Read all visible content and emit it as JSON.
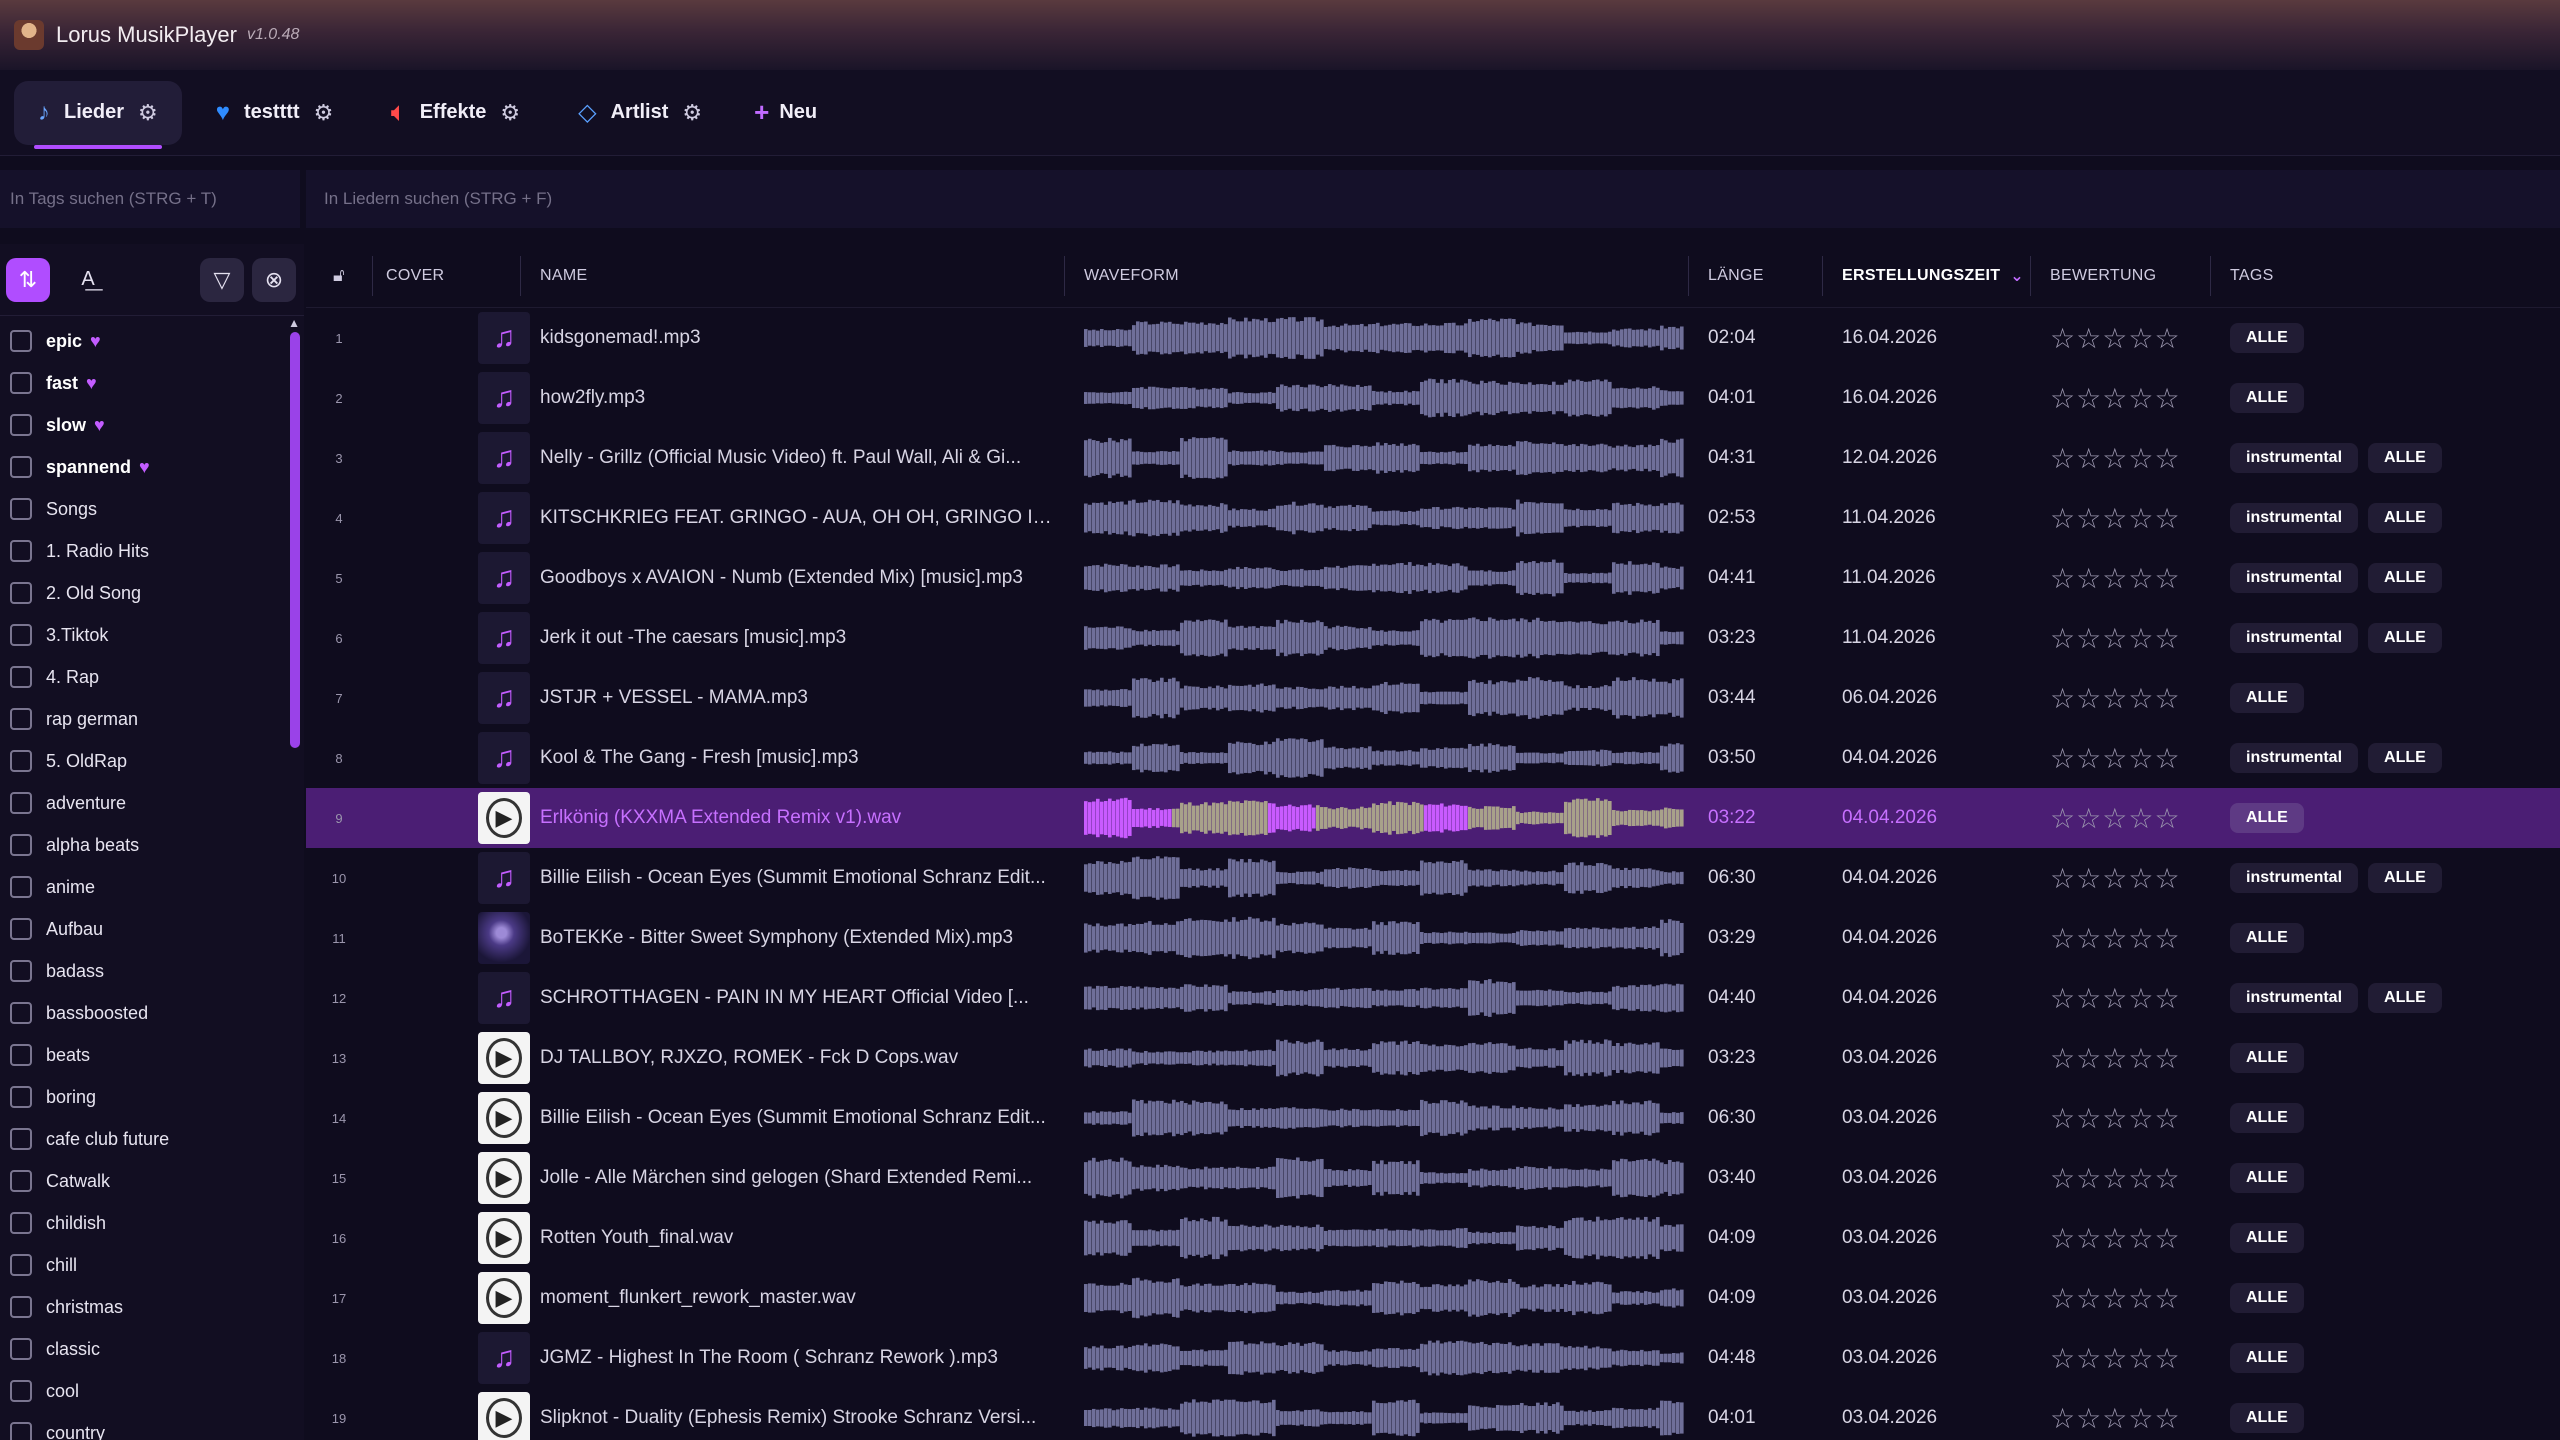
{
  "app": {
    "title": "Lorus MusikPlayer",
    "version": "v1.0.48"
  },
  "tabs": [
    {
      "label": "Lieder",
      "icon": "music-note-icon",
      "active": true
    },
    {
      "label": "testttt",
      "icon": "heart-icon",
      "active": false
    },
    {
      "label": "Effekte",
      "icon": "speaker-icon",
      "active": false
    },
    {
      "label": "Artlist",
      "icon": "tag-icon",
      "active": false
    }
  ],
  "new_tab_label": "Neu",
  "search": {
    "tags_placeholder": "In Tags suchen (STRG + T)",
    "songs_placeholder": "In Liedern suchen (STRG + F)"
  },
  "sidebar": {
    "tags": [
      {
        "label": "epic",
        "fav": true
      },
      {
        "label": "fast",
        "fav": true
      },
      {
        "label": "slow",
        "fav": true
      },
      {
        "label": "spannend",
        "fav": true
      },
      {
        "label": "Songs",
        "fav": false
      },
      {
        "label": "1. Radio Hits",
        "fav": false
      },
      {
        "label": "2. Old Song",
        "fav": false
      },
      {
        "label": "3.Tiktok",
        "fav": false
      },
      {
        "label": "4. Rap",
        "fav": false
      },
      {
        "label": "rap german",
        "fav": false
      },
      {
        "label": "5. OldRap",
        "fav": false
      },
      {
        "label": "adventure",
        "fav": false
      },
      {
        "label": "alpha beats",
        "fav": false
      },
      {
        "label": "anime",
        "fav": false
      },
      {
        "label": "Aufbau",
        "fav": false
      },
      {
        "label": "badass",
        "fav": false
      },
      {
        "label": "bassboosted",
        "fav": false
      },
      {
        "label": "beats",
        "fav": false
      },
      {
        "label": "boring",
        "fav": false
      },
      {
        "label": "cafe club future",
        "fav": false
      },
      {
        "label": "Catwalk",
        "fav": false
      },
      {
        "label": "childish",
        "fav": false
      },
      {
        "label": "chill",
        "fav": false
      },
      {
        "label": "christmas",
        "fav": false
      },
      {
        "label": "classic",
        "fav": false
      },
      {
        "label": "cool",
        "fav": false
      },
      {
        "label": "country",
        "fav": false
      }
    ]
  },
  "table": {
    "headers": {
      "cover": "COVER",
      "name": "NAME",
      "waveform": "WAVEFORM",
      "length": "LÄNGE",
      "created": "ERSTELLUNGSZEIT",
      "rating": "BEWERTUNG",
      "tags": "TAGS"
    },
    "sort_column": "ERSTELLUNGSZEIT",
    "rows": [
      {
        "n": "1",
        "cover": "note",
        "name": "kidsgonemad!.mp3",
        "length": "02:04",
        "date": "16.04.2026",
        "tags": [
          "ALLE"
        ]
      },
      {
        "n": "2",
        "cover": "note",
        "name": "how2fly.mp3",
        "length": "04:01",
        "date": "16.04.2026",
        "tags": [
          "ALLE"
        ]
      },
      {
        "n": "3",
        "cover": "note",
        "name": "Nelly - Grillz (Official Music Video) ft. Paul Wall, Ali & Gi...",
        "length": "04:31",
        "date": "12.04.2026",
        "tags": [
          "instrumental",
          "ALLE"
        ]
      },
      {
        "n": "4",
        "cover": "note",
        "name": "KITSCHKRIEG FEAT. GRINGO - AUA, OH OH, GRINGO IST...",
        "length": "02:53",
        "date": "11.04.2026",
        "tags": [
          "instrumental",
          "ALLE"
        ]
      },
      {
        "n": "5",
        "cover": "note",
        "name": "Goodboys x AVAION - Numb (Extended Mix) [music].mp3",
        "length": "04:41",
        "date": "11.04.2026",
        "tags": [
          "instrumental",
          "ALLE"
        ]
      },
      {
        "n": "6",
        "cover": "note",
        "name": "Jerk it out -The caesars [music].mp3",
        "length": "03:23",
        "date": "11.04.2026",
        "tags": [
          "instrumental",
          "ALLE"
        ]
      },
      {
        "n": "7",
        "cover": "note",
        "name": "JSTJR + VESSEL - MAMA.mp3",
        "length": "03:44",
        "date": "06.04.2026",
        "tags": [
          "ALLE"
        ]
      },
      {
        "n": "8",
        "cover": "note",
        "name": "Kool & The Gang - Fresh [music].mp3",
        "length": "03:50",
        "date": "04.04.2026",
        "tags": [
          "instrumental",
          "ALLE"
        ]
      },
      {
        "n": "9",
        "cover": "file",
        "name": "Erlkönig (KXXMA Extended Remix v1).wav",
        "length": "03:22",
        "date": "04.04.2026",
        "tags": [
          "ALLE"
        ],
        "selected": true
      },
      {
        "n": "10",
        "cover": "note",
        "name": "Billie Eilish - Ocean Eyes (Summit Emotional Schranz Edit...",
        "length": "06:30",
        "date": "04.04.2026",
        "tags": [
          "instrumental",
          "ALLE"
        ]
      },
      {
        "n": "11",
        "cover": "photo",
        "name": "BoTEKKe - Bitter Sweet Symphony (Extended Mix).mp3",
        "length": "03:29",
        "date": "04.04.2026",
        "tags": [
          "ALLE"
        ]
      },
      {
        "n": "12",
        "cover": "note",
        "name": "SCHROTTHAGEN - PAIN IN MY HEART   Official Video [...",
        "length": "04:40",
        "date": "04.04.2026",
        "tags": [
          "instrumental",
          "ALLE"
        ]
      },
      {
        "n": "13",
        "cover": "file",
        "name": "DJ TALLBOY, RJXZO, ROMEK - Fck D Cops.wav",
        "length": "03:23",
        "date": "03.04.2026",
        "tags": [
          "ALLE"
        ]
      },
      {
        "n": "14",
        "cover": "file",
        "name": "Billie Eilish - Ocean Eyes (Summit Emotional Schranz Edit...",
        "length": "06:30",
        "date": "03.04.2026",
        "tags": [
          "ALLE"
        ]
      },
      {
        "n": "15",
        "cover": "file",
        "name": "Jolle - Alle Märchen sind gelogen (Shard Extended Remi...",
        "length": "03:40",
        "date": "03.04.2026",
        "tags": [
          "ALLE"
        ]
      },
      {
        "n": "16",
        "cover": "file",
        "name": "Rotten Youth_final.wav",
        "length": "04:09",
        "date": "03.04.2026",
        "tags": [
          "ALLE"
        ]
      },
      {
        "n": "17",
        "cover": "file",
        "name": "moment_flunkert_rework_master.wav",
        "length": "04:09",
        "date": "03.04.2026",
        "tags": [
          "ALLE"
        ]
      },
      {
        "n": "18",
        "cover": "note",
        "name": "JGMZ - Highest In The Room ( Schranz Rework ).mp3",
        "length": "04:48",
        "date": "03.04.2026",
        "tags": [
          "ALLE"
        ]
      },
      {
        "n": "19",
        "cover": "file",
        "name": "Slipknot - Duality (Ephesis Remix) Strooke Schranz Versi...",
        "length": "04:01",
        "date": "03.04.2026",
        "tags": [
          "ALLE"
        ]
      }
    ]
  },
  "colors": {
    "accent": "#b04dff",
    "selected_row": "#4b1e74",
    "waveform": "#6f6f99",
    "waveform_played": "#c95bff"
  }
}
